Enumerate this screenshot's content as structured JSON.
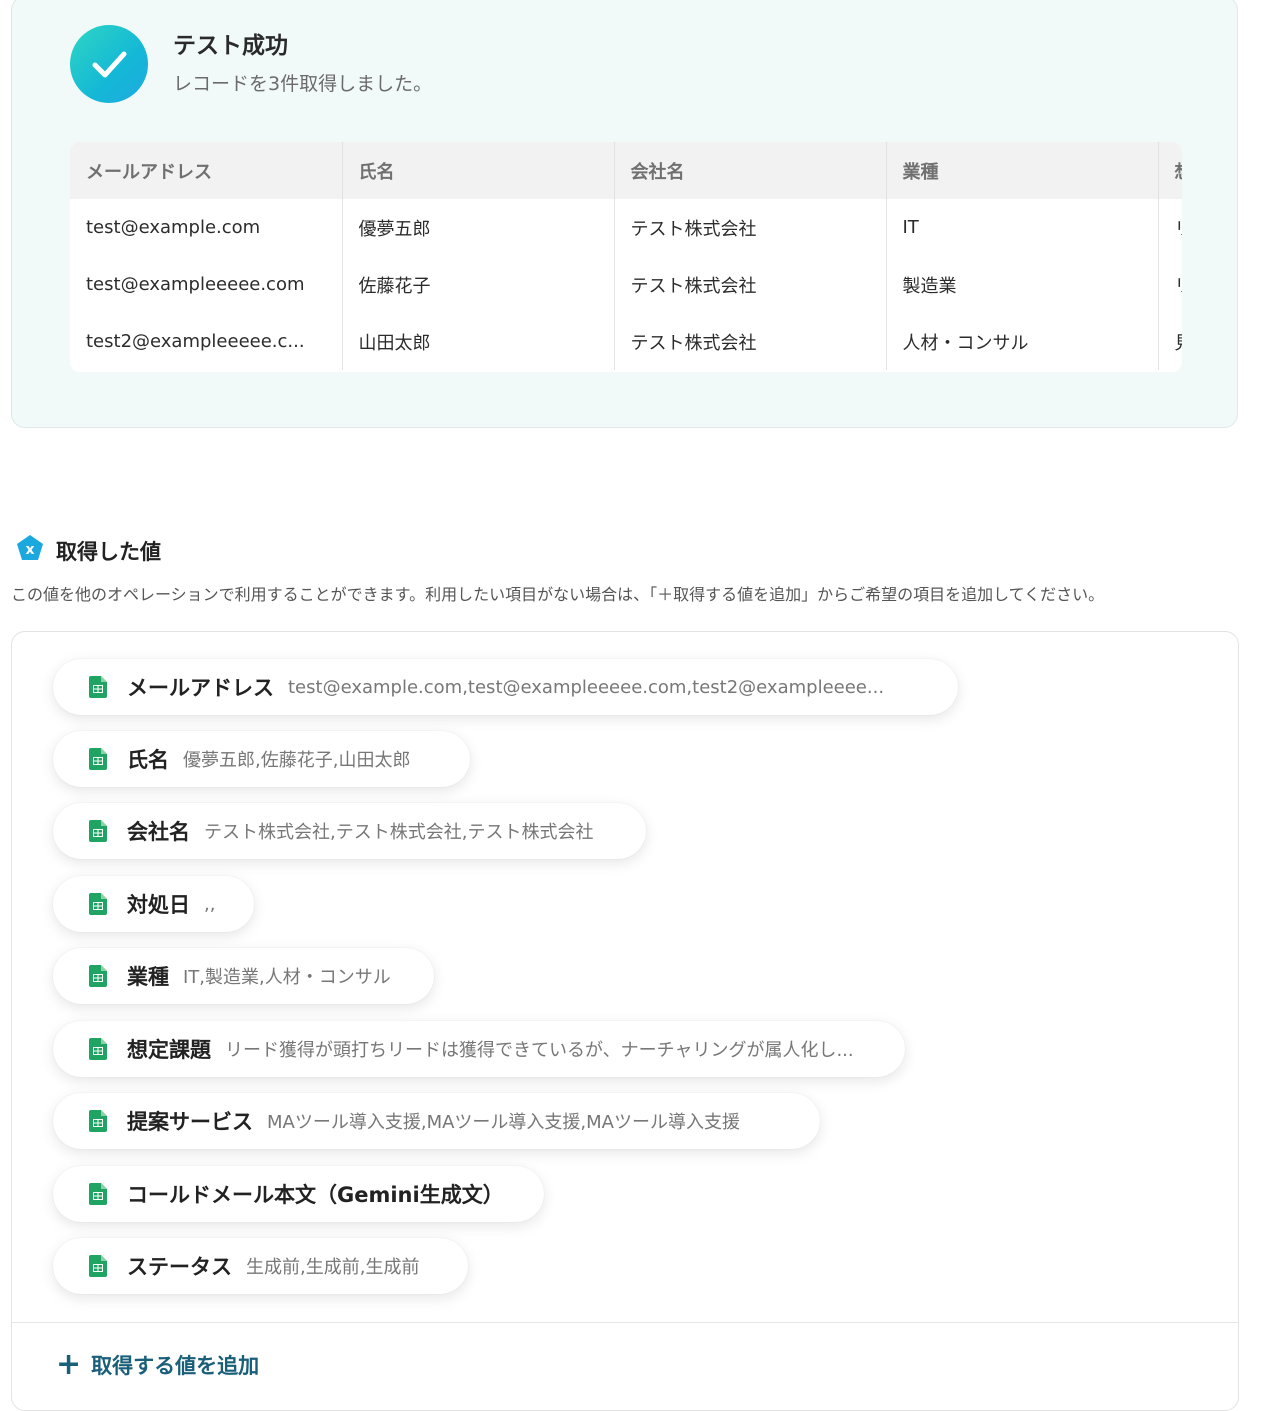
{
  "success": {
    "title": "テスト成功",
    "subtitle": "レコードを3件取得しました。"
  },
  "table": {
    "columns": [
      "メールアドレス",
      "氏名",
      "会社名",
      "業種",
      "想定課題"
    ],
    "rows": [
      [
        "test@example.com",
        "優夢五郎",
        "テスト株式会社",
        "IT",
        "リード獲得が頭打ち"
      ],
      [
        "test@exampleeeee.com",
        "佐藤花子",
        "テスト株式会社",
        "製造業",
        "リードは獲得できているが"
      ],
      [
        "test2@exampleeeee.c...",
        "山田太郎",
        "テスト株式会社",
        "人材・コンサル",
        "見込み"
      ]
    ]
  },
  "section": {
    "title": "取得した値",
    "description": "この値を他のオペレーションで利用することができます。利用したい項目がない場合は、「＋取得する値を追加」からご希望の項目を追加してください。"
  },
  "values": [
    {
      "label": "メールアドレス",
      "value": "test@example.com,test@exampleeeee.com,test2@exampleeee..."
    },
    {
      "label": "氏名",
      "value": "優夢五郎,佐藤花子,山田太郎"
    },
    {
      "label": "会社名",
      "value": "テスト株式会社,テスト株式会社,テスト株式会社"
    },
    {
      "label": "対処日",
      "value": ",,"
    },
    {
      "label": "業種",
      "value": "IT,製造業,人材・コンサル"
    },
    {
      "label": "想定課題",
      "value": "リード獲得が頭打ちリードは獲得できているが、ナーチャリングが属人化し..."
    },
    {
      "label": "提案サービス",
      "value": "MAツール導入支援,MAツール導入支援,MAツール導入支援"
    },
    {
      "label": "コールドメール本文（Gemini生成文）",
      "value": ",,"
    },
    {
      "label": "ステータス",
      "value": "生成前,生成前,生成前"
    }
  ],
  "add_button": {
    "label": "取得する値を追加",
    "icon": "plus-icon"
  },
  "colors": {
    "accent": "#1a5f7a",
    "success": "#14b8d6",
    "sheet_green": "#1fa463"
  }
}
